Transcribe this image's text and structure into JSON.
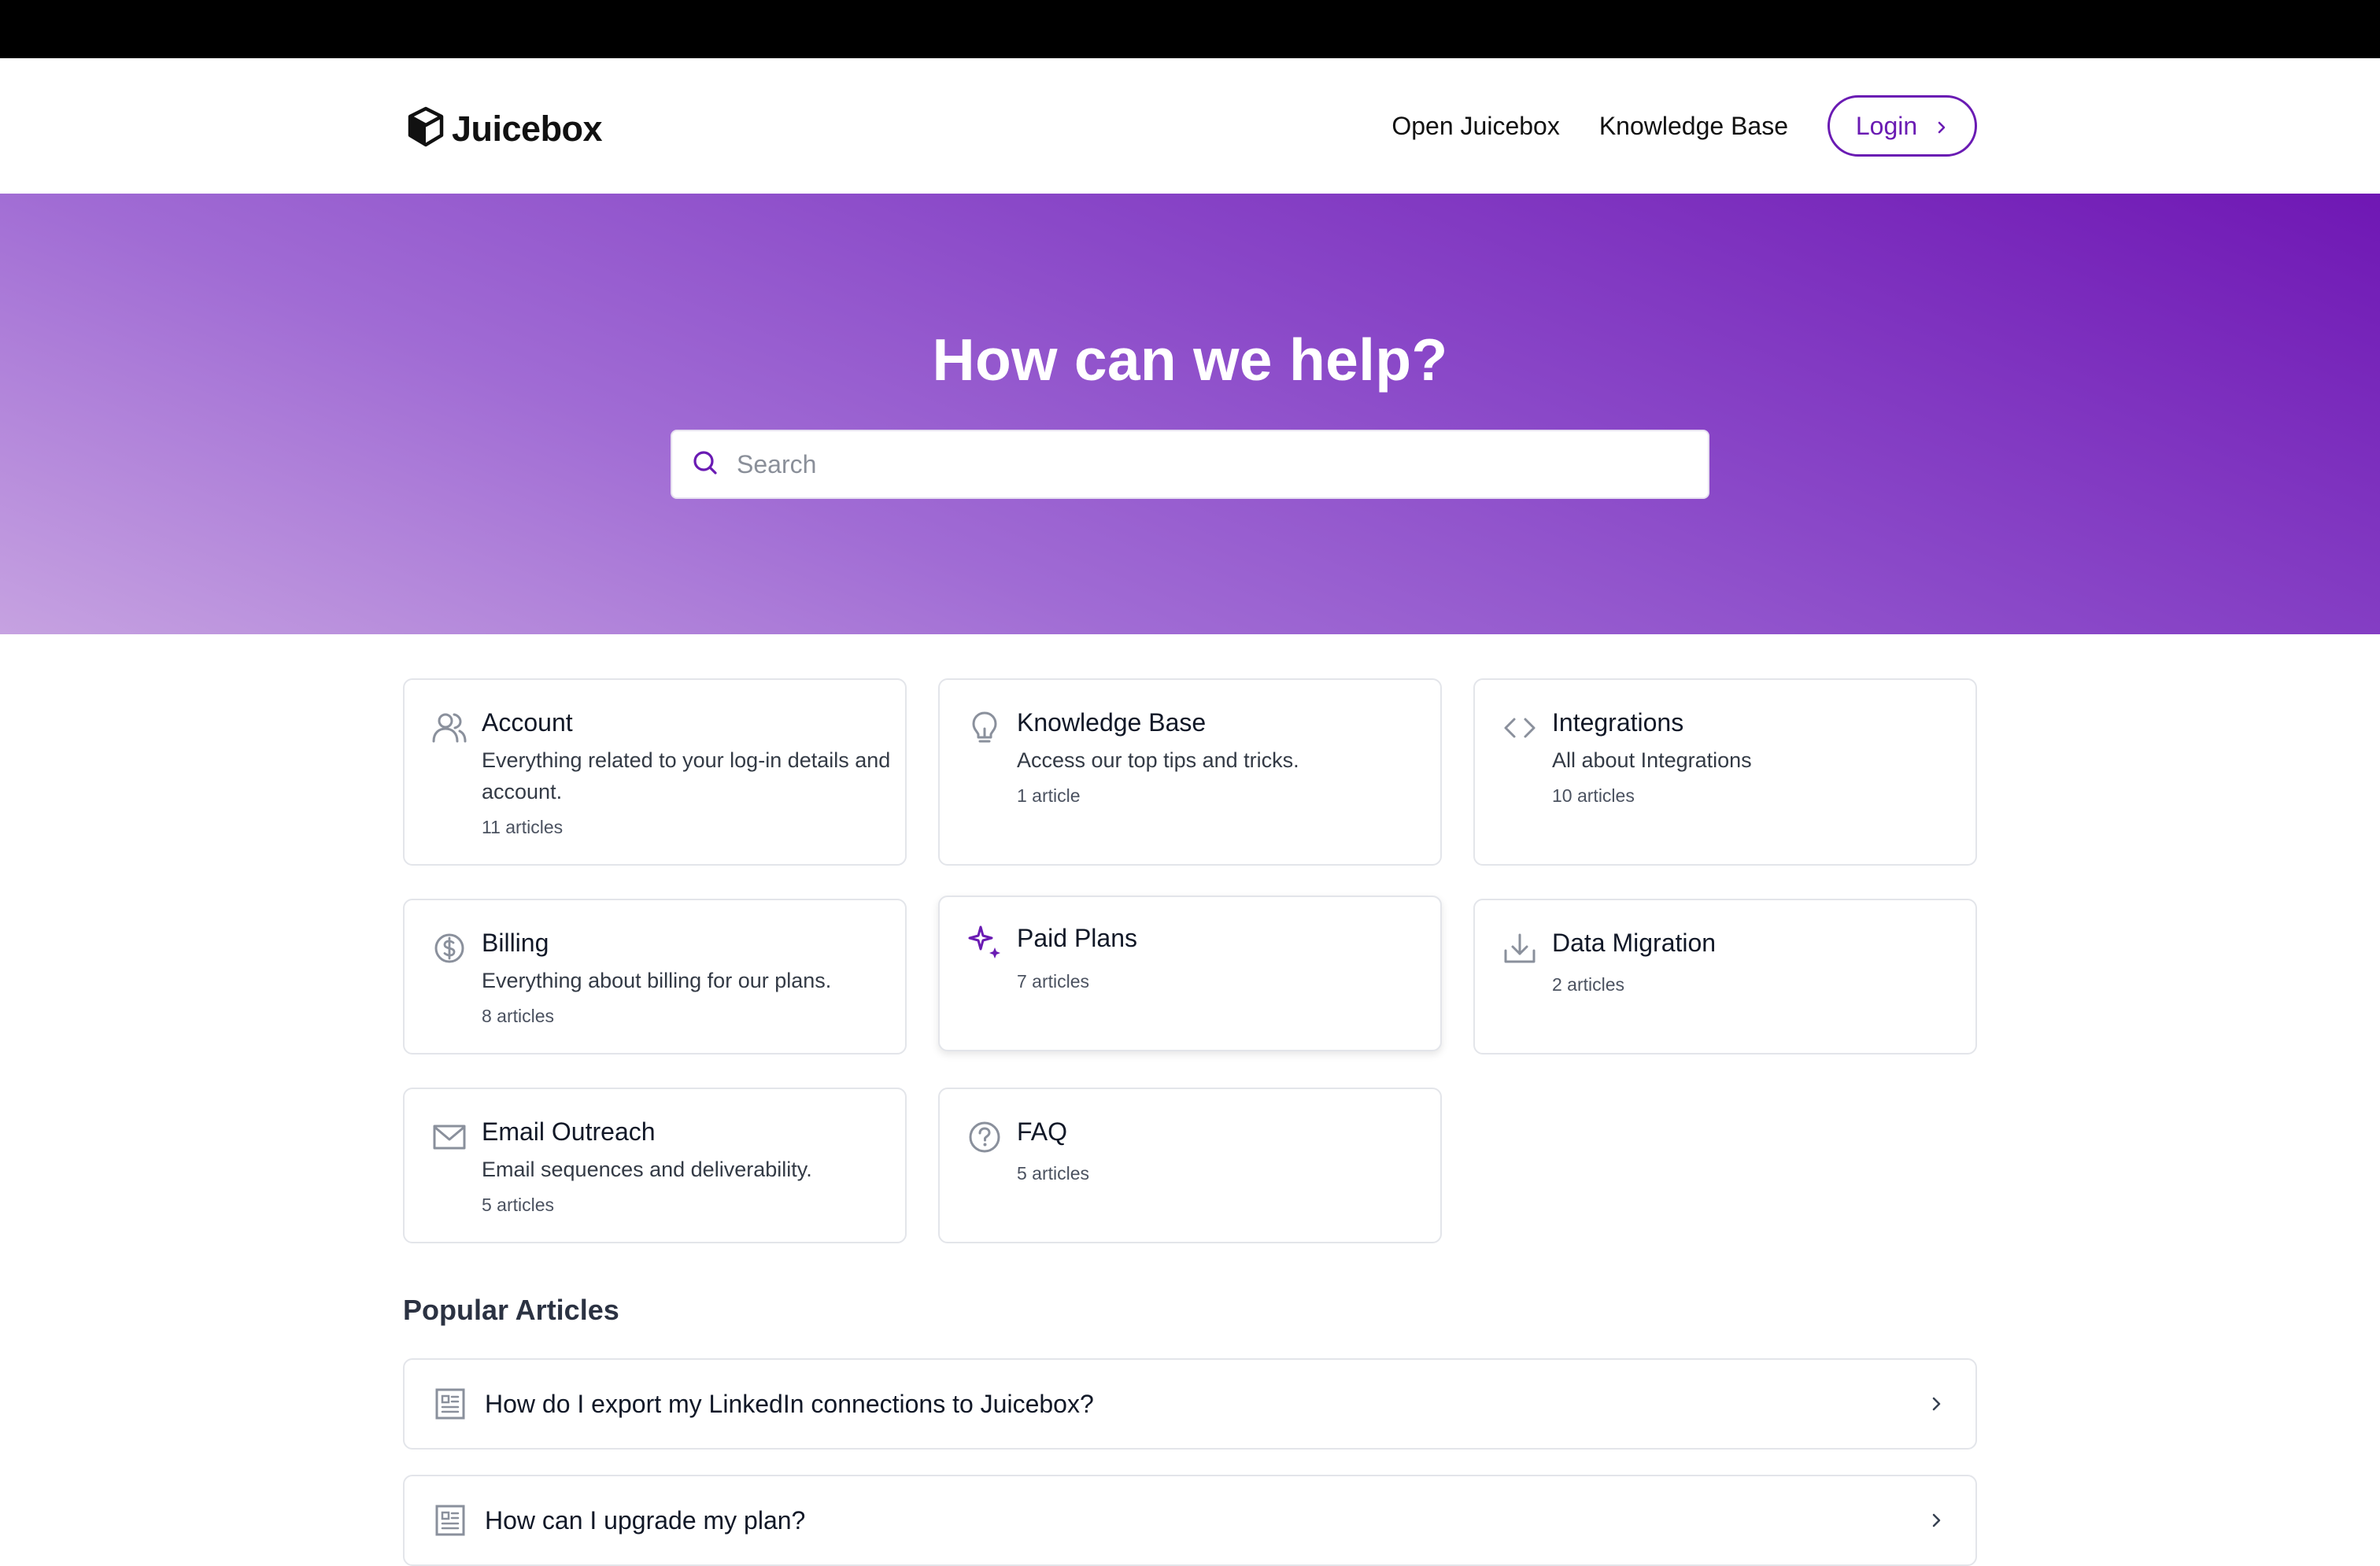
{
  "brand": {
    "name": "Juicebox"
  },
  "nav": {
    "open_app": "Open Juicebox",
    "knowledge_base": "Knowledge Base",
    "login": "Login"
  },
  "hero": {
    "title": "How can we help?",
    "search_placeholder": "Search"
  },
  "colors": {
    "accent": "#6a1bb3",
    "hero_gradient_start": "#c6a2e1",
    "hero_gradient_end": "#6f17b4"
  },
  "categories": [
    {
      "icon": "users-icon",
      "title": "Account",
      "description": "Everything related to your log-in details and account.",
      "count": "11 articles"
    },
    {
      "icon": "lightbulb-icon",
      "title": "Knowledge Base",
      "description": "Access our top tips and tricks.",
      "count": "1 article"
    },
    {
      "icon": "code-icon",
      "title": "Integrations",
      "description": "All about Integrations",
      "count": "10 articles"
    },
    {
      "icon": "dollar-circle-icon",
      "title": "Billing",
      "description": "Everything about billing for our plans.",
      "count": "8 articles"
    },
    {
      "icon": "sparkles-icon",
      "title": "Paid Plans",
      "description": "",
      "count": "7 articles"
    },
    {
      "icon": "download-tray-icon",
      "title": "Data Migration",
      "description": "",
      "count": "2 articles"
    },
    {
      "icon": "mail-icon",
      "title": "Email Outreach",
      "description": "Email sequences and deliverability.",
      "count": "5 articles"
    },
    {
      "icon": "question-circle-icon",
      "title": "FAQ",
      "description": "",
      "count": "5 articles"
    }
  ],
  "popular": {
    "title": "Popular Articles",
    "articles": [
      {
        "title": "How do I export my LinkedIn connections to Juicebox?"
      },
      {
        "title": "How can I upgrade my plan?"
      }
    ]
  }
}
